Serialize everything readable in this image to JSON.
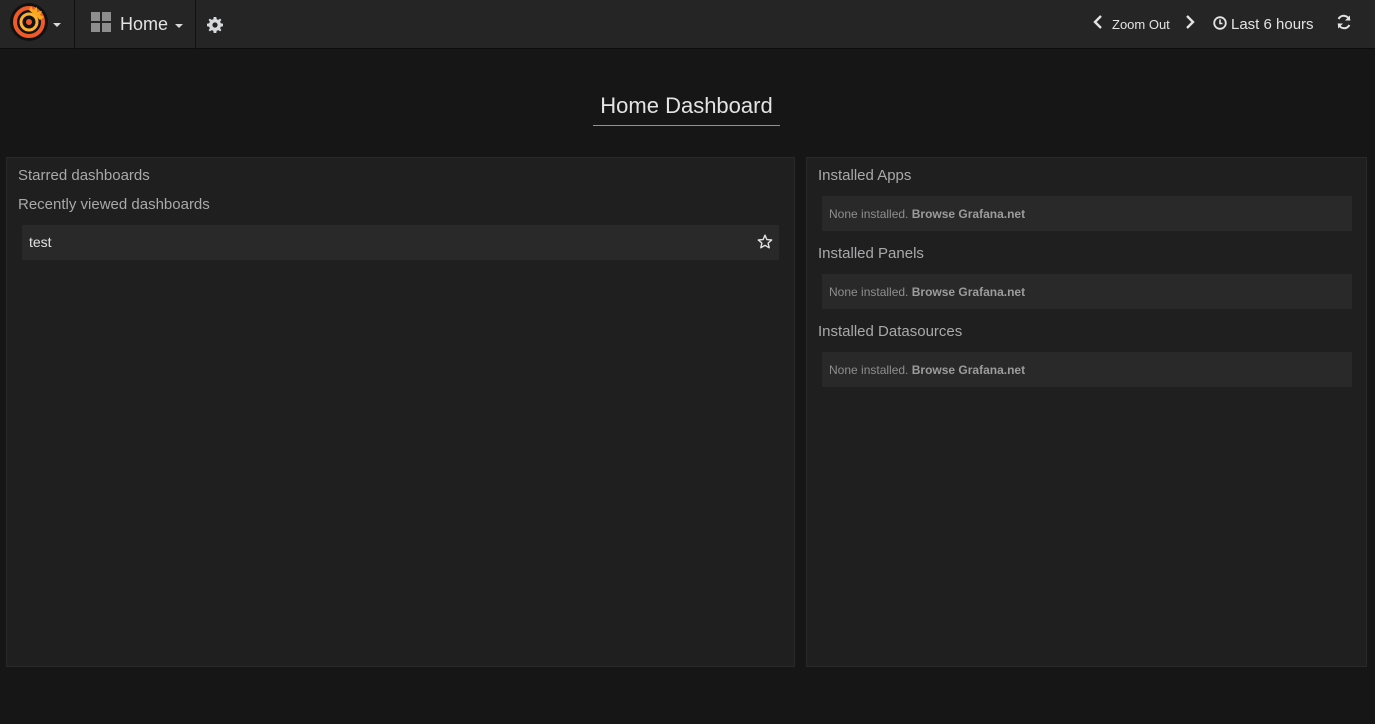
{
  "navbar": {
    "home_label": "Home",
    "zoom_out_label": "Zoom Out",
    "time_range_label": "Last 6 hours"
  },
  "page": {
    "title": "Home Dashboard"
  },
  "left_panel": {
    "starred_title": "Starred dashboards",
    "recent_title": "Recently viewed dashboards",
    "recent_items": [
      {
        "name": "test"
      }
    ]
  },
  "right_panel": {
    "sections": [
      {
        "title": "Installed Apps",
        "empty_text": "None installed.",
        "link_text": "Browse Grafana.net"
      },
      {
        "title": "Installed Panels",
        "empty_text": "None installed.",
        "link_text": "Browse Grafana.net"
      },
      {
        "title": "Installed Datasources",
        "empty_text": "None installed.",
        "link_text": "Browse Grafana.net"
      }
    ]
  },
  "icons": {
    "logo": "grafana-logo",
    "dashboard": "dashboard-grid-icon",
    "settings": "gear-icon",
    "prev": "chevron-left-icon",
    "next": "chevron-right-icon",
    "time": "clock-icon",
    "refresh": "refresh-icon",
    "star": "star-outline-icon"
  },
  "colors": {
    "accent": "#eb7b18",
    "background": "#161616",
    "panel": "#1f1f20",
    "navbar": "#252525"
  }
}
